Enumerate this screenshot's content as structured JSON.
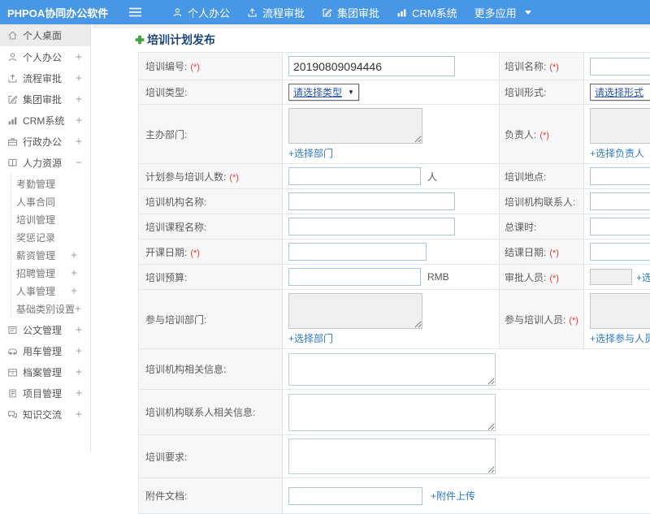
{
  "colors": {
    "header_blue": "#4797e6",
    "link_blue": "#2e78c2",
    "required_red": "#e03a3a",
    "title_navy": "#1b4575",
    "accent_green": "#3ba93b"
  },
  "header": {
    "brand": "PHPOA协同办公软件",
    "nav": [
      {
        "label": "个人办公",
        "icon": "user-icon"
      },
      {
        "label": "流程审批",
        "icon": "flow-icon"
      },
      {
        "label": "集团审批",
        "icon": "edit-icon"
      },
      {
        "label": "CRM系统",
        "icon": "chart-icon"
      },
      {
        "label": "更多应用",
        "icon": "caret-down-icon"
      }
    ]
  },
  "sidebar": {
    "items": [
      {
        "label": "个人桌面",
        "icon": "home-icon",
        "expand": ""
      },
      {
        "label": "个人办公",
        "icon": "user-icon",
        "expand": "+"
      },
      {
        "label": "流程审批",
        "icon": "flow-icon",
        "expand": "+"
      },
      {
        "label": "集团审批",
        "icon": "edit-icon",
        "expand": "+"
      },
      {
        "label": "CRM系统",
        "icon": "chart-icon",
        "expand": "+"
      },
      {
        "label": "行政办公",
        "icon": "briefcase-icon",
        "expand": "+"
      },
      {
        "label": "人力资源",
        "icon": "book-icon",
        "expand": "−"
      }
    ],
    "hr_children": [
      {
        "label": "考勤管理",
        "expand": ""
      },
      {
        "label": "人事合同",
        "expand": ""
      },
      {
        "label": "培训管理",
        "expand": ""
      },
      {
        "label": "奖惩记录",
        "expand": ""
      },
      {
        "label": "薪资管理",
        "expand": "+"
      },
      {
        "label": "招聘管理",
        "expand": "+"
      },
      {
        "label": "人事管理",
        "expand": "+"
      },
      {
        "label": "基础类别设置",
        "expand": "+"
      }
    ],
    "items_bottom": [
      {
        "label": "公文管理",
        "icon": "document-icon",
        "expand": "+"
      },
      {
        "label": "用车管理",
        "icon": "car-icon",
        "expand": "+"
      },
      {
        "label": "档案管理",
        "icon": "archive-icon",
        "expand": "+"
      },
      {
        "label": "项目管理",
        "icon": "project-icon",
        "expand": "+"
      },
      {
        "label": "知识交流",
        "icon": "chat-icon",
        "expand": "+"
      }
    ]
  },
  "form": {
    "title": "培训计划发布",
    "fields": {
      "trainingNo": {
        "label": "培训编号:",
        "req": "(*)",
        "value": "20190809094446"
      },
      "trainingName": {
        "label": "培训名称:",
        "req": "(*)"
      },
      "trainingType": {
        "label": "培训类型:",
        "value": "请选择类型"
      },
      "trainingForm": {
        "label": "培训形式:",
        "value": "请选择形式"
      },
      "hostDept": {
        "label": "主办部门:",
        "link": "+选择部门"
      },
      "leader": {
        "label": "负责人:",
        "req": "(*)",
        "link": "+选择负责人"
      },
      "plannedCount": {
        "label": "计划参与培训人数:",
        "req": "(*)",
        "suffix": "人"
      },
      "location": {
        "label": "培训地点:"
      },
      "orgName": {
        "label": "培训机构名称:"
      },
      "orgContact": {
        "label": "培训机构联系人:"
      },
      "courseName": {
        "label": "培训课程名称:"
      },
      "totalHours": {
        "label": "总课时:"
      },
      "startDate": {
        "label": "开课日期:",
        "req": "(*)"
      },
      "endDate": {
        "label": "结课日期:",
        "req": "(*)"
      },
      "budget": {
        "label": "培训预算:",
        "suffix": "RMB"
      },
      "approver": {
        "label": "审批人员:",
        "req": "(*)",
        "link": "+选择审批人员"
      },
      "joinDept": {
        "label": "参与培训部门:",
        "link": "+选择部门"
      },
      "joinPeople": {
        "label": "参与培训人员:",
        "req": "(*)",
        "link": "+选择参与人员"
      },
      "orgInfo": {
        "label": "培训机构相关信息:"
      },
      "orgContactInfo": {
        "label": "培训机构联系人相关信息:"
      },
      "requirement": {
        "label": "培训要求:"
      },
      "attachment": {
        "label": "附件文档:",
        "link": "+附件上传"
      }
    }
  }
}
